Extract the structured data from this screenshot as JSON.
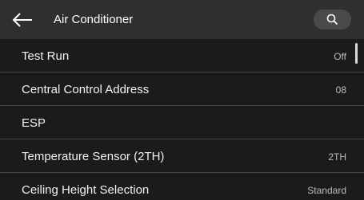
{
  "header": {
    "title": "Air Conditioner",
    "back_icon": "arrow-left-icon",
    "search_icon": "search-icon"
  },
  "settings": [
    {
      "label": "Test Run",
      "value": "Off"
    },
    {
      "label": "Central Control Address",
      "value": "08"
    },
    {
      "label": "ESP",
      "value": ""
    },
    {
      "label": "Temperature Sensor (2TH)",
      "value": "2TH"
    },
    {
      "label": "Ceiling Height Selection",
      "value": "Standard"
    }
  ],
  "colors": {
    "background": "#1b1b1b",
    "header": "#2f2f2f",
    "search_button": "#4a4a4a",
    "divider": "#474747"
  }
}
